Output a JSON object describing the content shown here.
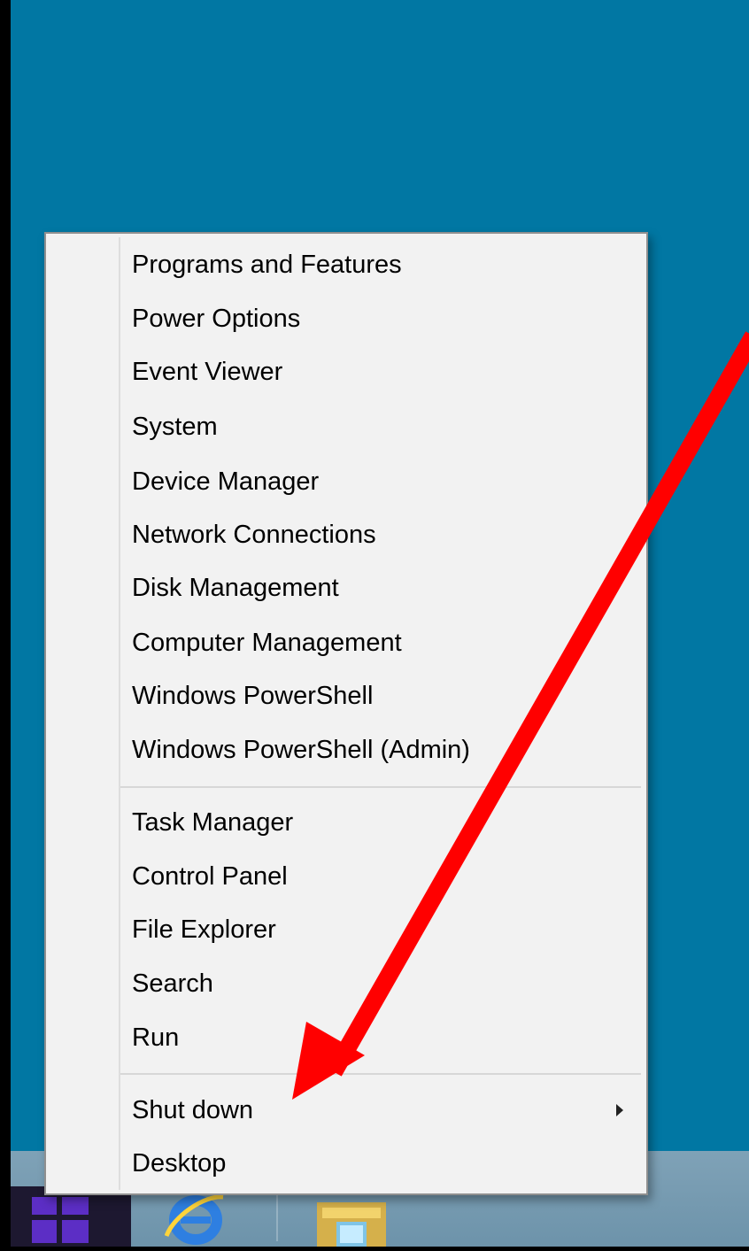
{
  "colors": {
    "desktop_background": "#0177a3",
    "menu_background": "#f2f2f2",
    "annotation_arrow": "#ff0000",
    "start_logo": "#5c2ec5"
  },
  "taskbar": {
    "icons": [
      "windows-start-icon",
      "internet-explorer-icon",
      "file-explorer-icon"
    ]
  },
  "context_menu": {
    "group1": [
      "Programs and Features",
      "Power Options",
      "Event Viewer",
      "System",
      "Device Manager",
      "Network Connections",
      "Disk Management",
      "Computer Management",
      "Windows PowerShell",
      "Windows PowerShell (Admin)"
    ],
    "group2": [
      "Task Manager",
      "Control Panel",
      "File Explorer",
      "Search",
      "Run"
    ],
    "group3": [
      "Shut down",
      "Desktop"
    ],
    "submenu_item": "Shut down"
  },
  "annotation": {
    "type": "arrow",
    "points_to": "Shut down"
  }
}
